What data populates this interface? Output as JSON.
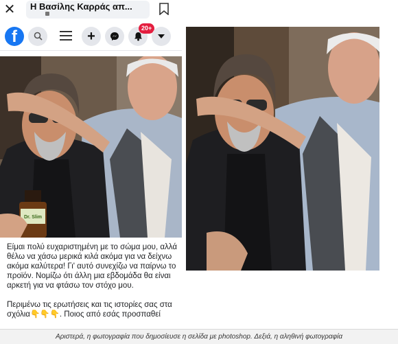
{
  "phone": {
    "page_title": "Η Βασίλης Καρράς απ...",
    "icons": {
      "close": "close-icon",
      "bookmark": "bookmark-icon",
      "lock": "lock-icon"
    },
    "nav": {
      "logo_letter": "f",
      "search_icon": "search-icon",
      "menu_icon": "menu-icon",
      "add_glyph": "+",
      "messenger_icon": "messenger-icon",
      "notifications_icon": "bell-icon",
      "notifications_badge": "20+",
      "dropdown_icon": "caret-down-icon"
    },
    "product_label": "Dr. Slim",
    "post_paragraphs": [
      "Είμαι πολύ ευχαριστημένη με το σώμα μου, αλλά θέλω να χάσω μερικά κιλά ακόμα για να δείχνω ακόμα καλύτερα! Γι' αυτό συνεχίζω να παίρνω το προϊόν. Νομίζω ότι άλλη μια εβδομάδα θα είναι αρκετή για να φτάσω τον στόχο μου.",
      "Περιμένω τις ερωτήσεις και τις ιστορίες σας στα σχόλια👇👇👇. Ποιος από εσάς προσπαθεί"
    ]
  },
  "colors": {
    "facebook_blue": "#1877f2",
    "badge_red": "#e41e3f"
  },
  "caption": "Αριστερά, η φωτογραφία που δημοσίευσε η σελίδα με photoshop. Δεξιά, η αληθινή φωτογραφία"
}
